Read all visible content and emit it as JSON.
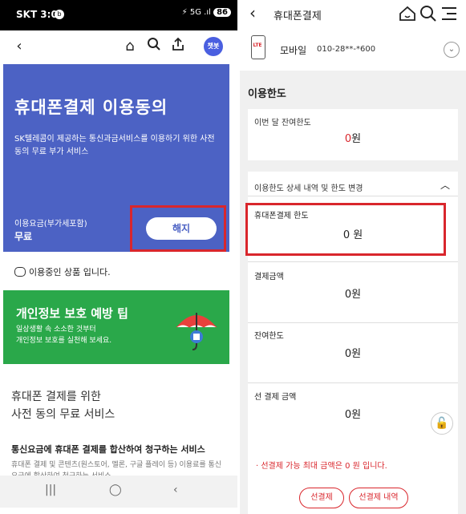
{
  "left": {
    "status": {
      "carrier_time": "SKT 3:09",
      "badge": "b",
      "signal": "⚡ 5G .ıl",
      "battery": "86"
    },
    "chatbot_label": "챗봇",
    "hero": {
      "title": "휴대폰결제 이용동의",
      "description": "SK텔레콤이 제공하는 통신과금서비스를 이용하기 위한 사전 동의 무료 부가 서비스",
      "fee_label": "이용요금(부가세포함)",
      "fee_value": "무료",
      "cancel_button": "해지"
    },
    "in_use_notice": "이용중인 상품 입니다.",
    "privacy_banner": {
      "title": "개인정보 보호 예방 팁",
      "description_line1": "일상생활 속 소소한 것부터",
      "description_line2": "개인정보 보호를 실천해 보세요."
    },
    "section_heading_line1": "휴대폰 결제를 위한",
    "section_heading_line2": "사전 동의 무료 서비스",
    "service_title": "통신요금에 휴대폰 결제를 합산하여 청구하는 서비스",
    "service_desc": "휴대폰 결제 및 콘텐츠(원스토어, 멜론, 구글 플레이 등) 이용료를 통신요금에 합산하여 청구하는 서비스"
  },
  "right": {
    "header_title": "휴대폰결제",
    "device": {
      "type_label": "LTE",
      "name": "모바일",
      "number": "010-28**-*600"
    },
    "limit_title": "이용한도",
    "monthly_remaining": {
      "label": "이번 달 잔여한도",
      "value_number": "0",
      "value_unit": "원"
    },
    "detail_toggle": "이용한도 상세 내역 및 한도 변경",
    "rows": [
      {
        "label": "휴대폰결제 한도",
        "value": "0 원"
      },
      {
        "label": "결제금액",
        "value": "0원"
      },
      {
        "label": "잔여한도",
        "value": "0원"
      },
      {
        "label": "선 결제 금액",
        "value": "0원"
      }
    ],
    "notice": "· 선결제 가능 최대 금액은 0 원 입니다.",
    "buttons": {
      "prepay": "선결제",
      "prepay_history": "선결제 내역"
    }
  },
  "colors": {
    "hero_blue": "#4c62c4",
    "green": "#2aa84a",
    "highlight_red": "#d9262c"
  }
}
